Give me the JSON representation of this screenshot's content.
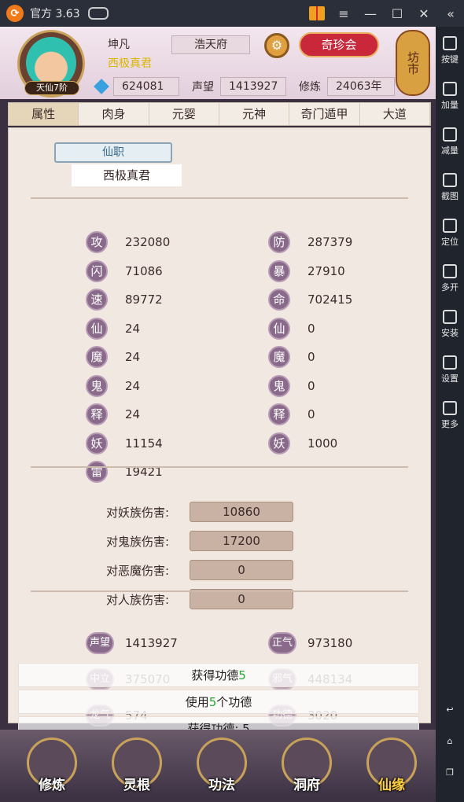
{
  "window": {
    "title": "官方 3.63",
    "close": "✕",
    "max": "☐",
    "min": "—",
    "menu": "≡",
    "collapse": "«"
  },
  "side_toolbar": [
    {
      "label": "按键",
      "icon": "keyboard-icon"
    },
    {
      "label": "加量",
      "icon": "volume-up-icon"
    },
    {
      "label": "减量",
      "icon": "volume-down-icon"
    },
    {
      "label": "截图",
      "icon": "scissors-icon"
    },
    {
      "label": "定位",
      "icon": "location-pin-icon"
    },
    {
      "label": "多开",
      "icon": "multi-window-icon"
    },
    {
      "label": "安装",
      "icon": "apk-install-icon"
    },
    {
      "label": "设置",
      "icon": "gear-icon"
    },
    {
      "label": "更多",
      "icon": "more-dots-icon"
    }
  ],
  "android_nav": [
    "back-icon",
    "home-icon",
    "recents-icon"
  ],
  "player": {
    "name": "坤凡",
    "title": "西极真君",
    "level": "天仙7阶",
    "server": "浩天府",
    "treasure_button": "奇珍会",
    "market": "坊市",
    "spirit_stones": "624081",
    "reputation_label": "声望",
    "reputation": "1413927",
    "cultivation_label": "修炼",
    "cultivation": "24063年"
  },
  "tabs": [
    "属性",
    "肉身",
    "元婴",
    "元神",
    "奇门遁甲",
    "大道"
  ],
  "active_tab": "属性",
  "job": {
    "label": "仙职",
    "name": "西极真君"
  },
  "attributes_left": [
    {
      "icon": "攻",
      "value": "232080",
      "info": false
    },
    {
      "icon": "闪",
      "value": "71086",
      "info": false
    },
    {
      "icon": "速",
      "value": "89772",
      "info": false
    },
    {
      "icon": "仙",
      "value": "24",
      "info": true
    },
    {
      "icon": "魔",
      "value": "24",
      "info": true
    },
    {
      "icon": "鬼",
      "value": "24",
      "info": true
    },
    {
      "icon": "释",
      "value": "24",
      "info": true
    },
    {
      "icon": "妖",
      "value": "11154",
      "info": true
    },
    {
      "icon": "雷",
      "value": "19421",
      "info": false
    }
  ],
  "attributes_right": [
    {
      "icon": "防",
      "value": "287379",
      "info": false
    },
    {
      "icon": "暴",
      "value": "27910",
      "info": false
    },
    {
      "icon": "命",
      "value": "702415",
      "info": false
    },
    {
      "icon": "仙",
      "value": "0",
      "info": true
    },
    {
      "icon": "魔",
      "value": "0",
      "info": true
    },
    {
      "icon": "鬼",
      "value": "0",
      "info": true
    },
    {
      "icon": "释",
      "value": "0",
      "info": true
    },
    {
      "icon": "妖",
      "value": "1000",
      "info": true
    }
  ],
  "damage_bonuses": [
    {
      "label": "对妖族伤害:",
      "value": "10860"
    },
    {
      "label": "对鬼族伤害:",
      "value": "17200"
    },
    {
      "label": "对恶魔伤害:",
      "value": "0"
    },
    {
      "label": "对人族伤害:",
      "value": "0"
    }
  ],
  "reputation_stats": [
    {
      "icon": "声望",
      "value": "1413927"
    },
    {
      "icon": "正气",
      "value": "973180"
    },
    {
      "icon": "中立",
      "value": "375070"
    },
    {
      "icon": "邪气",
      "value": "448134"
    },
    {
      "icon": "龙气",
      "value": "574"
    },
    {
      "icon": "功德",
      "value": "3020"
    }
  ],
  "toasts": [
    {
      "pre": "获得功德",
      "num": "5",
      "post": ""
    },
    {
      "pre": "使用",
      "num": "5",
      "post": "个功德"
    },
    {
      "pre": "获得功德: 5",
      "num": "",
      "post": ""
    }
  ],
  "bottom_nav": [
    {
      "label": "修炼",
      "icon": "meditating-monk-icon"
    },
    {
      "label": "灵根",
      "icon": "yin-yang-sword-icon"
    },
    {
      "label": "功法",
      "icon": "scroll-book-icon"
    },
    {
      "label": "洞府",
      "icon": "pavilion-icon"
    },
    {
      "label": "仙缘",
      "icon": "gourd-icon"
    }
  ]
}
